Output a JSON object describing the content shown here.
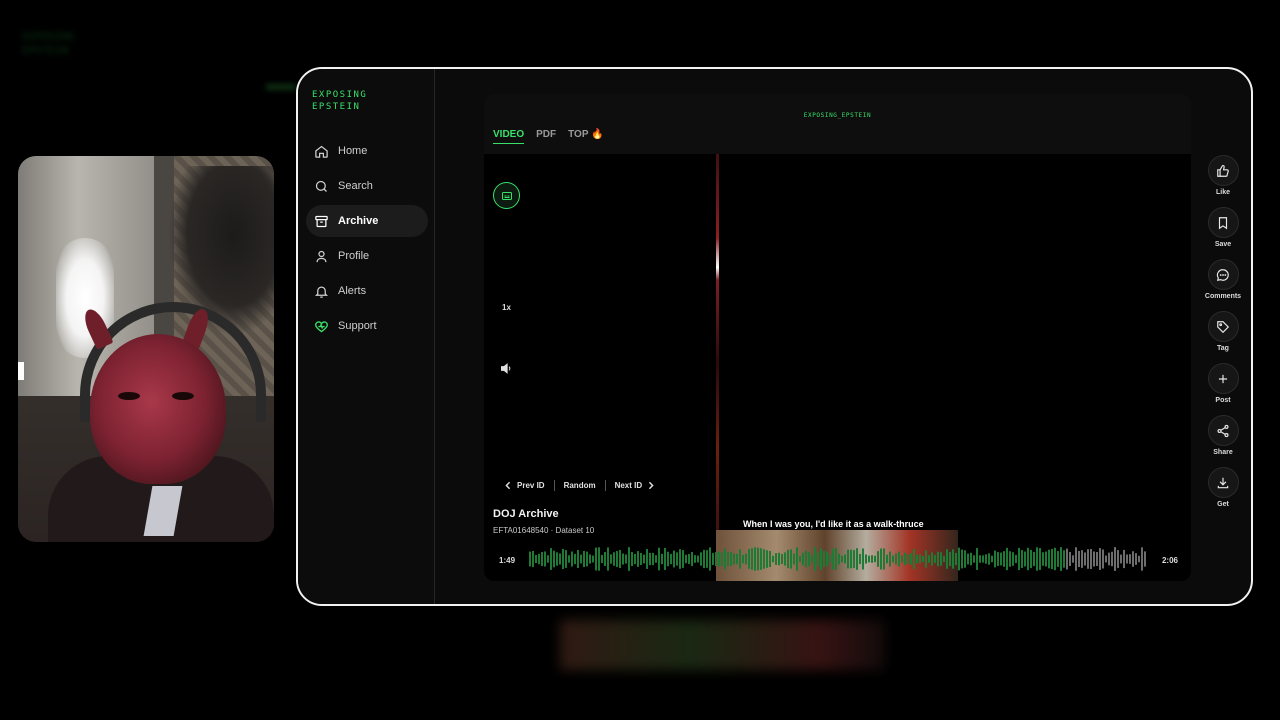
{
  "brand": {
    "logo_line1": "EXPOSING",
    "logo_line2": "EPSTEIN",
    "panel_brand": "EXPOSING_EPSTEIN"
  },
  "sidebar": {
    "items": [
      {
        "label": "Home",
        "icon": "home-icon",
        "active": false
      },
      {
        "label": "Search",
        "icon": "search-icon",
        "active": false
      },
      {
        "label": "Archive",
        "icon": "archive-icon",
        "active": true
      },
      {
        "label": "Profile",
        "icon": "profile-icon",
        "active": false
      },
      {
        "label": "Alerts",
        "icon": "bell-icon",
        "active": false
      },
      {
        "label": "Support",
        "icon": "heart-icon",
        "active": false
      }
    ]
  },
  "tabs": [
    {
      "label": "VIDEO",
      "active": true
    },
    {
      "label": "PDF",
      "active": false
    },
    {
      "label": "TOP 🔥",
      "active": false
    }
  ],
  "player": {
    "speed": "1x",
    "prev_label": "Prev ID",
    "random_label": "Random",
    "next_label": "Next ID",
    "title": "DOJ Archive",
    "subtitle": "EFTA01648540 · Dataset 10",
    "caption": "When I was you, I'd like it as a walk-thruce",
    "time_current": "1:49",
    "time_total": "2:06",
    "progress": 0.865
  },
  "actions": [
    {
      "label": "Like",
      "icon": "thumbs-up-icon"
    },
    {
      "label": "Save",
      "icon": "bookmark-icon"
    },
    {
      "label": "Comments",
      "icon": "comment-icon"
    },
    {
      "label": "Tag",
      "icon": "tag-icon"
    },
    {
      "label": "Post",
      "icon": "plus-icon"
    },
    {
      "label": "Share",
      "icon": "share-icon"
    },
    {
      "label": "Get",
      "icon": "download-icon"
    }
  ],
  "colors": {
    "accent": "#39e06a",
    "background": "#000000",
    "panel": "#0e0e0e"
  }
}
